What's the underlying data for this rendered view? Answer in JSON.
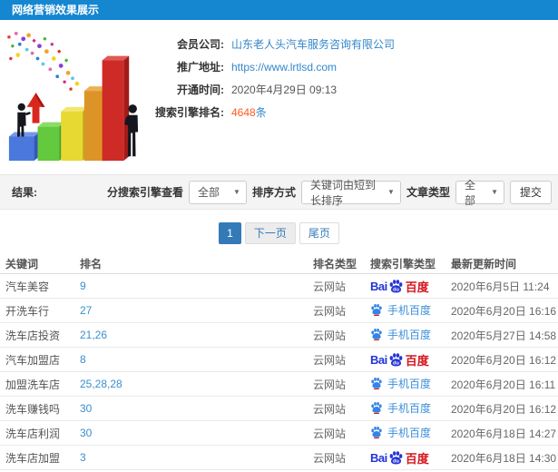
{
  "header": {
    "title": "网络营销效果展示"
  },
  "info": {
    "fields": [
      {
        "label": "会员公司:",
        "value": "山东老人头汽车服务咨询有限公司",
        "type": "link"
      },
      {
        "label": "推广地址:",
        "value": "https://www.lrtlsd.com",
        "type": "link"
      },
      {
        "label": "开通时间:",
        "value": "2020年4月29日 09:13",
        "type": "text"
      },
      {
        "label": "搜索引擎排名:",
        "value": "4648",
        "suffix": "条",
        "type": "highlight"
      }
    ]
  },
  "filters": {
    "result_label": "结果:",
    "engine_label": "分搜索引擎查看",
    "engine_value": "全部",
    "sort_label": "排序方式",
    "sort_value": "关键词由短到长排序",
    "article_label": "文章类型",
    "article_value": "全部",
    "submit_label": "提交"
  },
  "pagination": {
    "current": "1",
    "next": "下一页",
    "last": "尾页"
  },
  "table": {
    "headers": [
      "关键词",
      "排名",
      "排名类型",
      "搜索引擎类型",
      "最新更新时间"
    ],
    "engine_labels": {
      "baidu": {
        "bai": "Bai",
        "du": "du",
        "cn": "百度"
      },
      "mobile": "手机百度"
    },
    "rows": [
      {
        "keyword": "汽车美容",
        "rank": "9",
        "rank_type": "云网站",
        "engine": "baidu",
        "updated": "2020年6月5日 11:24"
      },
      {
        "keyword": "开洗车行",
        "rank": "27",
        "rank_type": "云网站",
        "engine": "mobile",
        "updated": "2020年6月20日 16:16"
      },
      {
        "keyword": "洗车店投资",
        "rank": "21,26",
        "rank_type": "云网站",
        "engine": "mobile",
        "updated": "2020年5月27日 14:58"
      },
      {
        "keyword": "汽车加盟店",
        "rank": "8",
        "rank_type": "云网站",
        "engine": "baidu",
        "updated": "2020年6月20日 16:12"
      },
      {
        "keyword": "加盟洗车店",
        "rank": "25,28,28",
        "rank_type": "云网站",
        "engine": "mobile",
        "updated": "2020年6月20日 16:11"
      },
      {
        "keyword": "洗车赚钱吗",
        "rank": "30",
        "rank_type": "云网站",
        "engine": "mobile",
        "updated": "2020年6月20日 16:12"
      },
      {
        "keyword": "洗车店利润",
        "rank": "30",
        "rank_type": "云网站",
        "engine": "mobile",
        "updated": "2020年6月18日 14:27"
      },
      {
        "keyword": "洗车店加盟",
        "rank": "3",
        "rank_type": "云网站",
        "engine": "baidu",
        "updated": "2020年6月18日 14:30"
      }
    ]
  },
  "colors": {
    "topbar_blue": "#1586d0",
    "link_blue": "#3387c9",
    "highlight_orange": "#ff5a1e",
    "baidu_blue": "#2534d6",
    "baidu_red": "#d6131d",
    "mobile_baidu_blue": "#3d8fd8",
    "pagination_active": "#337ab7"
  }
}
